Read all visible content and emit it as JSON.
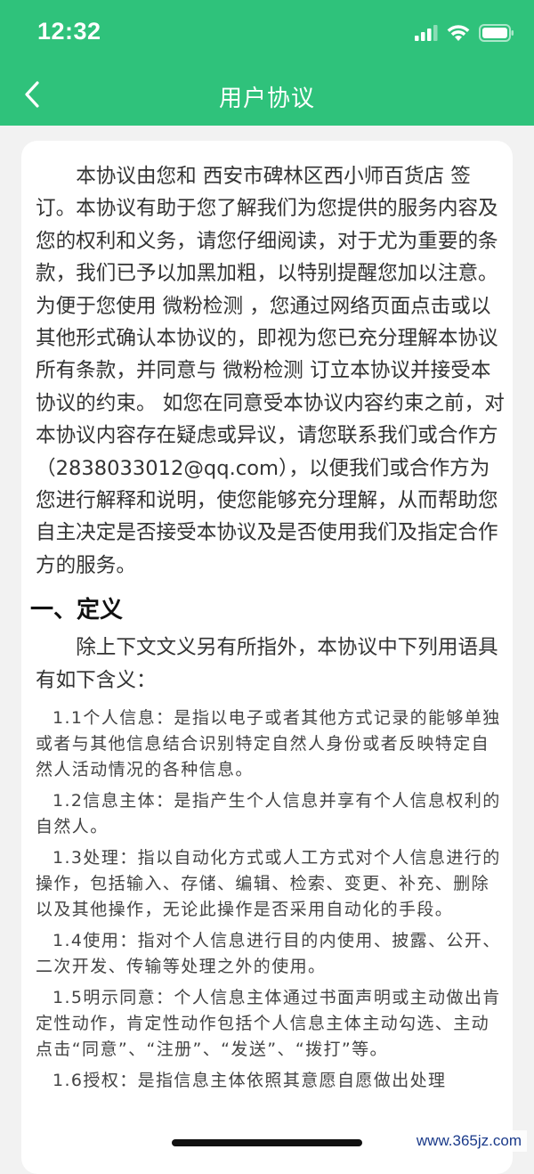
{
  "status_bar": {
    "time": "12:32"
  },
  "nav": {
    "title": "用户协议",
    "back_icon": "chevron-left-icon"
  },
  "agreement": {
    "intro": "本协议由您和 西安市碑林区西小师百货店 签订。本协议有助于您了解我们为您提供的服务内容及您的权利和义务，请您仔细阅读，对于尤为重要的条款，我们已予以加黑加粗，以特别提醒您加以注意。 为便于您使用 微粉检测 ，您通过网络页面点击或以其他形式确认本协议的，即视为您已充分理解本协议所有条款，并同意与 微粉检测 订立本协议并接受本协议的约束。 如您在同意受本协议内容约束之前，对本协议内容存在疑虑或异议，请您联系我们或合作方（2838033012@qq.com），以便我们或合作方为您进行解释和说明，使您能够充分理解，从而帮助您自主决定是否接受本协议及是否使用我们及指定合作方的服务。",
    "section1": {
      "heading": "一、定义",
      "intro": "除上下文文义另有所指外，本协议中下列用语具有如下含义：",
      "items": [
        "1.1个人信息：是指以电子或者其他方式记录的能够单独或者与其他信息结合识别特定自然人身份或者反映特定自然人活动情况的各种信息。",
        "1.2信息主体：是指产生个人信息并享有个人信息权利的自然人。",
        "1.3处理：指以自动化方式或人工方式对个人信息进行的操作，包括输入、存储、编辑、检索、变更、补充、删除以及其他操作，无论此操作是否采用自动化的手段。",
        "1.4使用：指对个人信息进行目的内使用、披露、公开、二次开发、传输等处理之外的使用。",
        "1.5明示同意：个人信息主体通过书面声明或主动做出肯定性动作，肯定性动作包括个人信息主体主动勾选、主动点击“同意”、“注册”、“发送”、“拨打”等。",
        "1.6授权：是指信息主体依照其意愿自愿做出处理"
      ]
    }
  },
  "watermark": "www.365jz.com",
  "colors": {
    "header_green": "#2fc27b",
    "page_bg": "#f2f2f2",
    "card_bg": "#ffffff"
  }
}
